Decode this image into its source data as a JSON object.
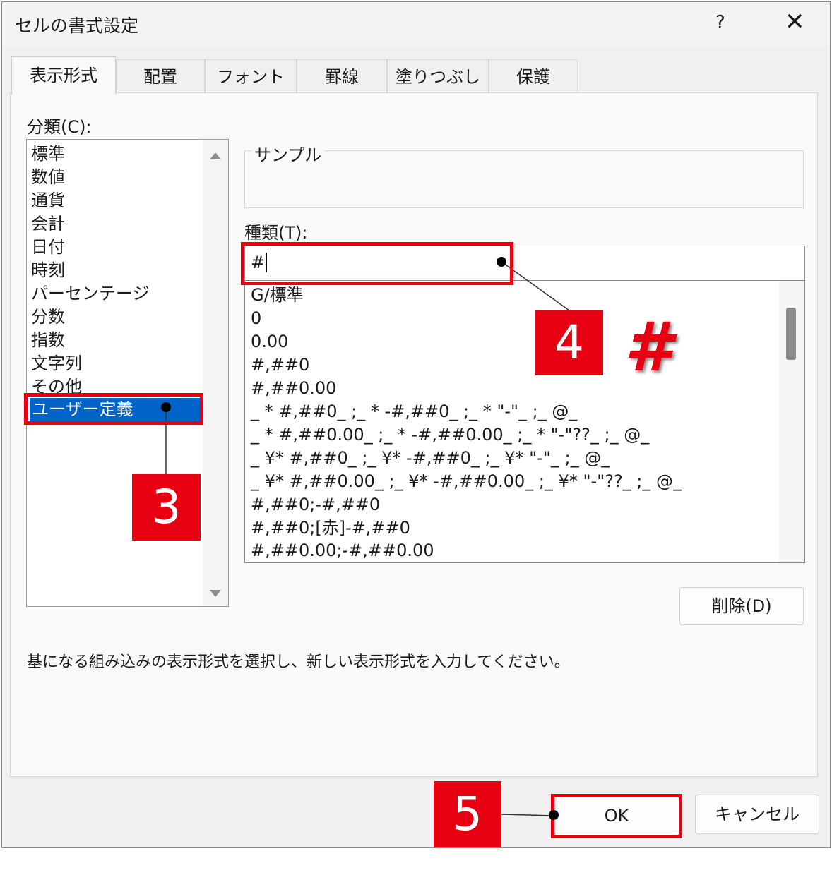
{
  "window": {
    "title": "セルの書式設定",
    "help_label": "?",
    "close_label": "✕"
  },
  "tabs": [
    {
      "label": "表示形式"
    },
    {
      "label": "配置"
    },
    {
      "label": "フォント"
    },
    {
      "label": "罫線"
    },
    {
      "label": "塗りつぶし"
    },
    {
      "label": "保護"
    }
  ],
  "category": {
    "label": "分類(C):",
    "items": [
      "標準",
      "数値",
      "通貨",
      "会計",
      "日付",
      "時刻",
      "パーセンテージ",
      "分数",
      "指数",
      "文字列",
      "その他",
      "ユーザー定義"
    ],
    "selected": "ユーザー定義"
  },
  "sample": {
    "label": "サンプル"
  },
  "type": {
    "label": "種類(T):",
    "value": "#",
    "formats": [
      "G/標準",
      "0",
      "0.00",
      "#,##0",
      "#,##0.00",
      "_ * #,##0_ ;_ * -#,##0_ ;_ * \"-\"_ ;_ @_",
      "_ * #,##0.00_ ;_ * -#,##0.00_ ;_ * \"-\"??_ ;_ @_",
      "_ ¥* #,##0_ ;_ ¥* -#,##0_ ;_ ¥* \"-\"_ ;_ @_",
      "_ ¥* #,##0.00_ ;_ ¥* -#,##0.00_ ;_ ¥* \"-\"??_ ;_ @_",
      "#,##0;-#,##0",
      "#,##0;[赤]-#,##0",
      "#,##0.00;-#,##0.00"
    ]
  },
  "buttons": {
    "delete": "削除(D)",
    "ok": "OK",
    "cancel": "キャンセル"
  },
  "hint": "基になる組み込みの表示形式を選択し、新しい表示形式を入力してください。",
  "annotations": {
    "step3": "3",
    "step4": "4",
    "step5": "5",
    "hash_symbol": "#",
    "accent_color": "#e60012"
  }
}
